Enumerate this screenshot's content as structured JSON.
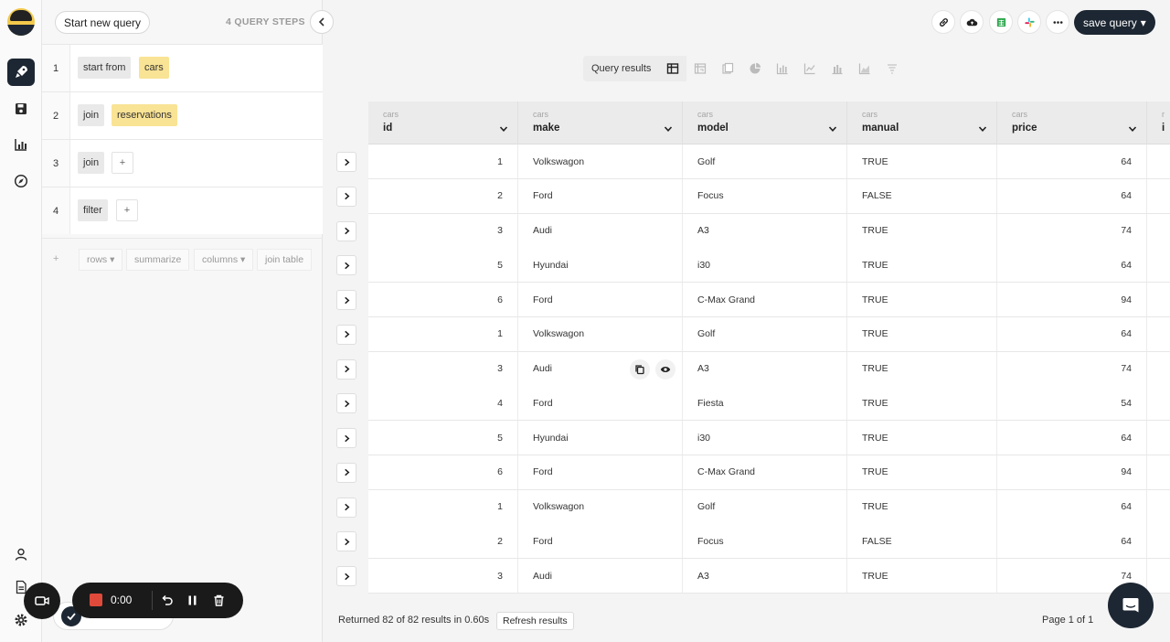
{
  "query_panel": {
    "new_query_label": "Start new query",
    "steps_count_label": "4 QUERY STEPS",
    "steps": [
      {
        "num": "1",
        "chips": [
          {
            "label": "start from",
            "style": "gray"
          },
          {
            "label": "cars",
            "style": "yellow"
          }
        ]
      },
      {
        "num": "2",
        "chips": [
          {
            "label": "join",
            "style": "gray"
          },
          {
            "label": "reservations",
            "style": "yellow"
          }
        ]
      },
      {
        "num": "3",
        "chips": [
          {
            "label": "join",
            "style": "gray"
          },
          {
            "label": "+",
            "style": "plus"
          }
        ]
      },
      {
        "num": "4",
        "chips": [
          {
            "label": "filter",
            "style": "gray"
          },
          {
            "label": "+",
            "style": "plus"
          }
        ]
      }
    ],
    "add_step": {
      "plus": "+",
      "rows": "rows",
      "summarize": "summarize",
      "columns": "columns",
      "join_table": "join table"
    }
  },
  "toolbar": {
    "save_label": "save query",
    "icons": [
      "link-icon",
      "cloud-upload-icon",
      "google-sheets-icon",
      "slack-icon",
      "more-icon"
    ]
  },
  "viz_tabs": {
    "active_label": "Query results",
    "icons": [
      "table-icon",
      "pivot-icon",
      "single-value-icon",
      "pie-chart-icon",
      "bar-chart-icon",
      "line-chart-icon",
      "stacked-bar-icon",
      "area-chart-icon",
      "funnel-icon"
    ]
  },
  "table": {
    "columns": [
      {
        "table": "cars",
        "name": "id",
        "align": "num"
      },
      {
        "table": "cars",
        "name": "make",
        "align": "text"
      },
      {
        "table": "cars",
        "name": "model",
        "align": "text"
      },
      {
        "table": "cars",
        "name": "manual",
        "align": "text"
      },
      {
        "table": "cars",
        "name": "price",
        "align": "num"
      },
      {
        "table": "r",
        "name": "i",
        "align": "text"
      }
    ],
    "rows": [
      [
        "1",
        "Volkswagon",
        "Golf",
        "TRUE",
        "64"
      ],
      [
        "2",
        "Ford",
        "Focus",
        "FALSE",
        "64"
      ],
      [
        "3",
        "Audi",
        "A3",
        "TRUE",
        "74"
      ],
      [
        "5",
        "Hyundai",
        "i30",
        "TRUE",
        "64"
      ],
      [
        "6",
        "Ford",
        "C-Max Grand",
        "TRUE",
        "94"
      ],
      [
        "1",
        "Volkswagon",
        "Golf",
        "TRUE",
        "64"
      ],
      [
        "3",
        "Audi",
        "A3",
        "TRUE",
        "74"
      ],
      [
        "4",
        "Ford",
        "Fiesta",
        "TRUE",
        "54"
      ],
      [
        "5",
        "Hyundai",
        "i30",
        "TRUE",
        "64"
      ],
      [
        "6",
        "Ford",
        "C-Max Grand",
        "TRUE",
        "94"
      ],
      [
        "1",
        "Volkswagon",
        "Golf",
        "TRUE",
        "64"
      ],
      [
        "2",
        "Ford",
        "Focus",
        "FALSE",
        "64"
      ],
      [
        "3",
        "Audi",
        "A3",
        "TRUE",
        "74"
      ]
    ],
    "hover_row": 6,
    "hover_actions": [
      "copy-icon",
      "eye-icon"
    ]
  },
  "footer": {
    "status": "Returned 82 of 82 results in 0.60s",
    "refresh_label": "Refresh results",
    "page_label": "Page 1 of 1"
  },
  "recorder": {
    "time": "0:00"
  },
  "colors": {
    "accent_dark": "#1d2733",
    "chip_yellow": "#f9e394",
    "record_red": "#e04a3a"
  }
}
